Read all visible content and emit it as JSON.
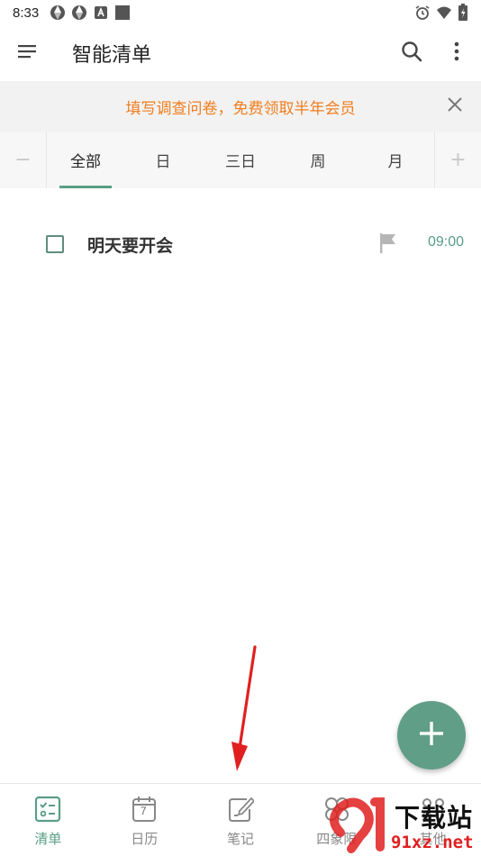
{
  "status_bar": {
    "time": "8:33",
    "left_icons": [
      "shutter-icon",
      "shutter-icon",
      "app-a-icon",
      "square-icon"
    ],
    "right_icons": [
      "alarm-icon",
      "wifi-icon",
      "battery-icon"
    ]
  },
  "app_bar": {
    "title": "智能清单",
    "icons": [
      "menu-icon",
      "search-icon",
      "more-vert-icon"
    ]
  },
  "banner": {
    "text": "填写调查问卷，免费领取半年会员",
    "color": "#f07e1e"
  },
  "tabs": {
    "left_control": "−",
    "right_control": "+",
    "items": [
      {
        "label": "全部",
        "active": true
      },
      {
        "label": "日",
        "active": false
      },
      {
        "label": "三日",
        "active": false
      },
      {
        "label": "周",
        "active": false
      },
      {
        "label": "月",
        "active": false
      }
    ]
  },
  "tasks": [
    {
      "title": "明天要开会",
      "time": "09:00",
      "completed": false,
      "flag_icon": "flag-icon"
    }
  ],
  "fab": {
    "icon": "plus-icon",
    "color": "#609e87"
  },
  "bottom_nav": {
    "items": [
      {
        "label": "清单",
        "icon": "checklist-icon",
        "active": true
      },
      {
        "label": "日历",
        "icon": "calendar-icon",
        "active": false,
        "calendar_day": "7"
      },
      {
        "label": "笔记",
        "icon": "note-edit-icon",
        "active": false
      },
      {
        "label": "四象限",
        "icon": "quadrant-icon",
        "active": false
      },
      {
        "label": "其他",
        "icon": "other-icon",
        "active": false
      }
    ]
  },
  "watermark": {
    "text": "下载站",
    "url": "91xz.net"
  },
  "colors": {
    "accent": "#5a9e84",
    "banner_bg": "#f2f2f2",
    "tab_bg": "#f7f7f7",
    "annotation_arrow": "#e02020"
  }
}
